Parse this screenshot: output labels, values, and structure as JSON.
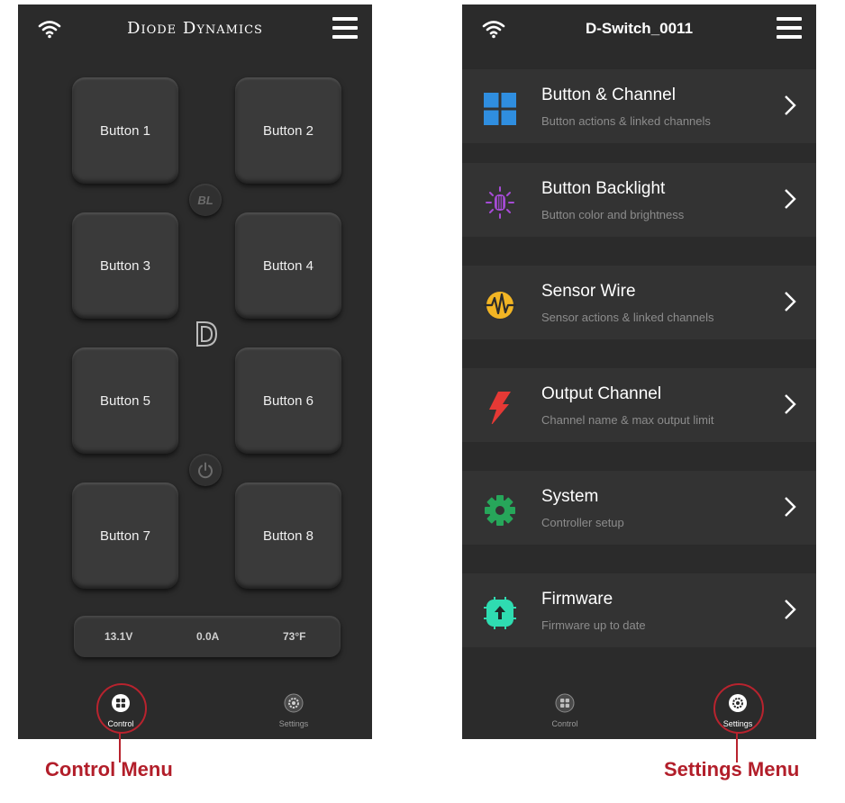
{
  "control_screen": {
    "brand": "Diode Dynamics",
    "icons": {
      "wifi": "wifi-icon",
      "menu": "hamburger-menu-icon",
      "logo": "diode-d-logo"
    },
    "buttons": [
      "Button 1",
      "Button 2",
      "Button 3",
      "Button 4",
      "Button 5",
      "Button 6",
      "Button 7",
      "Button 8"
    ],
    "backlight_label": "BL",
    "status": {
      "voltage": "13.1V",
      "current": "0.0A",
      "temperature": "73°F"
    },
    "nav": {
      "control": "Control",
      "settings": "Settings"
    }
  },
  "settings_screen": {
    "title": "D-Switch_0011",
    "items": [
      {
        "title": "Button & Channel",
        "subtitle": "Button actions & linked channels",
        "icon": "grid-icon",
        "color": "#2f8ee0"
      },
      {
        "title": "Button Backlight",
        "subtitle": "Button color and brightness",
        "icon": "backlight-icon",
        "color": "#a64bd6"
      },
      {
        "title": "Sensor Wire",
        "subtitle": "Sensor actions & linked channels",
        "icon": "sensor-wave-icon",
        "color": "#f2b524"
      },
      {
        "title": "Output Channel",
        "subtitle": "Channel name & max output limit",
        "icon": "lightning-icon",
        "color": "#e53935"
      },
      {
        "title": "System",
        "subtitle": "Controller setup",
        "icon": "gear-icon",
        "color": "#27a65a"
      },
      {
        "title": "Firmware",
        "subtitle": "Firmware up to date",
        "icon": "firmware-upload-icon",
        "color": "#2fdcb1"
      }
    ],
    "nav": {
      "control": "Control",
      "settings": "Settings"
    }
  },
  "captions": {
    "left": "Control Menu",
    "right": "Settings Menu"
  },
  "colors": {
    "app_bg": "#2b2b2b",
    "highlight": "#b8232e",
    "caption": "#b21e2a"
  }
}
